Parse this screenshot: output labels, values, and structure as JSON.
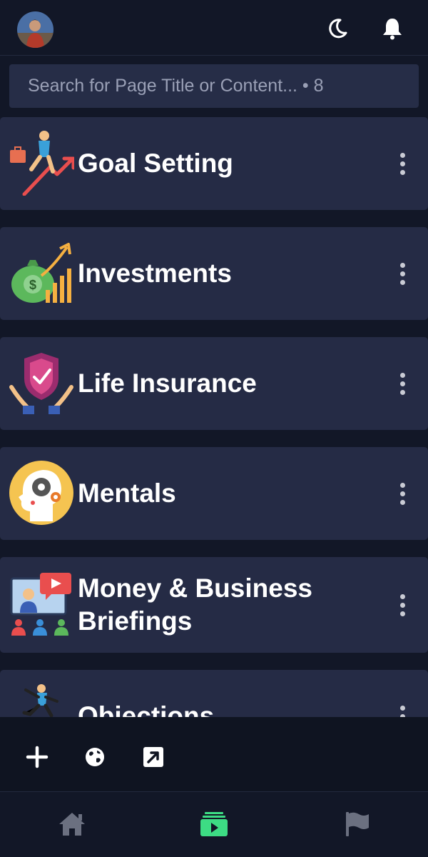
{
  "header": {
    "avatar_icon": "user-avatar",
    "theme_icon": "moon-icon",
    "notifications_icon": "bell-icon"
  },
  "search": {
    "placeholder": "Search for Page Title or Content... • 8"
  },
  "pages": [
    {
      "title": "Goal Setting",
      "icon": "goal-setting-icon"
    },
    {
      "title": "Investments",
      "icon": "investments-icon"
    },
    {
      "title": "Life Insurance",
      "icon": "life-insurance-icon"
    },
    {
      "title": "Mentals",
      "icon": "mentals-icon"
    },
    {
      "title": "Money & Business Briefings",
      "icon": "business-briefings-icon"
    },
    {
      "title": "Objections",
      "icon": "objections-icon"
    }
  ],
  "actions": [
    {
      "icon": "plus-icon"
    },
    {
      "icon": "globe-icon"
    },
    {
      "icon": "external-link-icon"
    }
  ],
  "tabs": [
    {
      "icon": "home-icon",
      "active": false
    },
    {
      "icon": "media-folder-icon",
      "active": true
    },
    {
      "icon": "flag-icon",
      "active": false
    }
  ],
  "colors": {
    "background": "#121727",
    "card": "#252b45",
    "active_tab": "#3ddc84",
    "inactive_tab": "#6b7080"
  }
}
